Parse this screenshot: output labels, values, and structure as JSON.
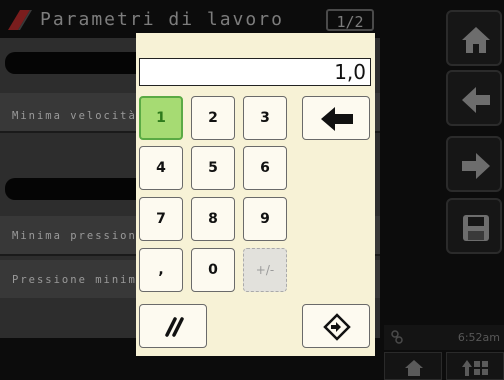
{
  "header": {
    "title": "Parametri di lavoro",
    "page_indicator": "1/2"
  },
  "params": [
    {
      "label": "Minima velocità"
    },
    {
      "label": "Minima pressione"
    },
    {
      "label": "Pressione minima"
    }
  ],
  "keypad": {
    "display_value": "1,0",
    "keys": [
      "1",
      "2",
      "3",
      "4",
      "5",
      "6",
      "7",
      "8",
      "9",
      ",",
      "0",
      "+/-"
    ],
    "selected_key": "1",
    "disabled_key": "+/-"
  },
  "status": {
    "time": "6:52am"
  },
  "nav_icons": [
    "home-icon",
    "arrow-left-icon",
    "arrow-right-icon",
    "save-icon"
  ],
  "colors": {
    "keypad_bg": "#f7f2d6",
    "selected_key": "#a6db73",
    "background": "#0c0c0c"
  }
}
